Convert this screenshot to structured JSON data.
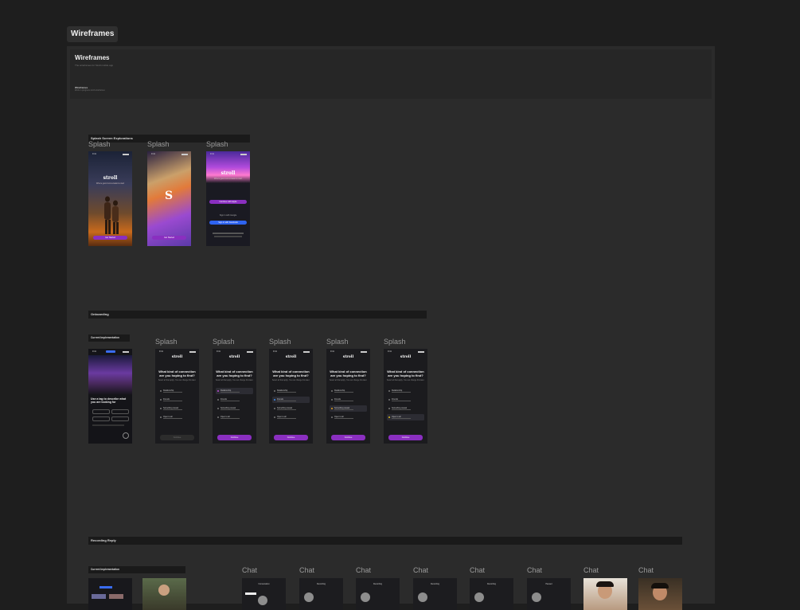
{
  "page_tab": "Wireframes",
  "board": {
    "title": "Wireframes",
    "subtitle": "The wireframes for Stroll mobile app",
    "small_title": "Wireframes",
    "small_subtitle": "Work in progress stroll wireframes"
  },
  "sections": {
    "splash": {
      "title": "Splash Screen Explorations",
      "frames": [
        "Splash",
        "Splash",
        "Splash"
      ]
    },
    "onboarding": {
      "title": "Onboarding",
      "current_label": "Current Implementation",
      "frames": [
        "Splash",
        "Splash",
        "Splash",
        "Splash",
        "Splash"
      ]
    },
    "recording": {
      "title": "Recording Reply",
      "current_label": "Current Implementation",
      "frames": [
        "Chat",
        "Chat",
        "Chat",
        "Chat",
        "Chat",
        "Chat",
        "Chat",
        "Chat"
      ]
    }
  },
  "phone": {
    "time": "9:41",
    "logo": "stroll",
    "tagline": "Where good conversations start",
    "get_started": "Get Started",
    "sign_in_apple": "Continue with Apple",
    "sign_in_google": "Sign in with Google",
    "sign_in_facebook": "Sign in with Facebook",
    "question": "What kind of connection are you hoping to find?",
    "question_sub": "Select all that apply. You can change this later.",
    "options": [
      "Relationship",
      "Friends",
      "Something casual",
      "Open to all"
    ],
    "continue": "Continue",
    "onboard_prompt": "Use a tag to describe what you are looking for",
    "chat_names": [
      "Conversation",
      "Recording",
      "Recording",
      "Recording",
      "Paused"
    ]
  },
  "colors": {
    "accent": "#8a2fc0",
    "blue": "#2e63f0",
    "board": "#2b2b2b",
    "canvas": "#1e1e1e"
  }
}
